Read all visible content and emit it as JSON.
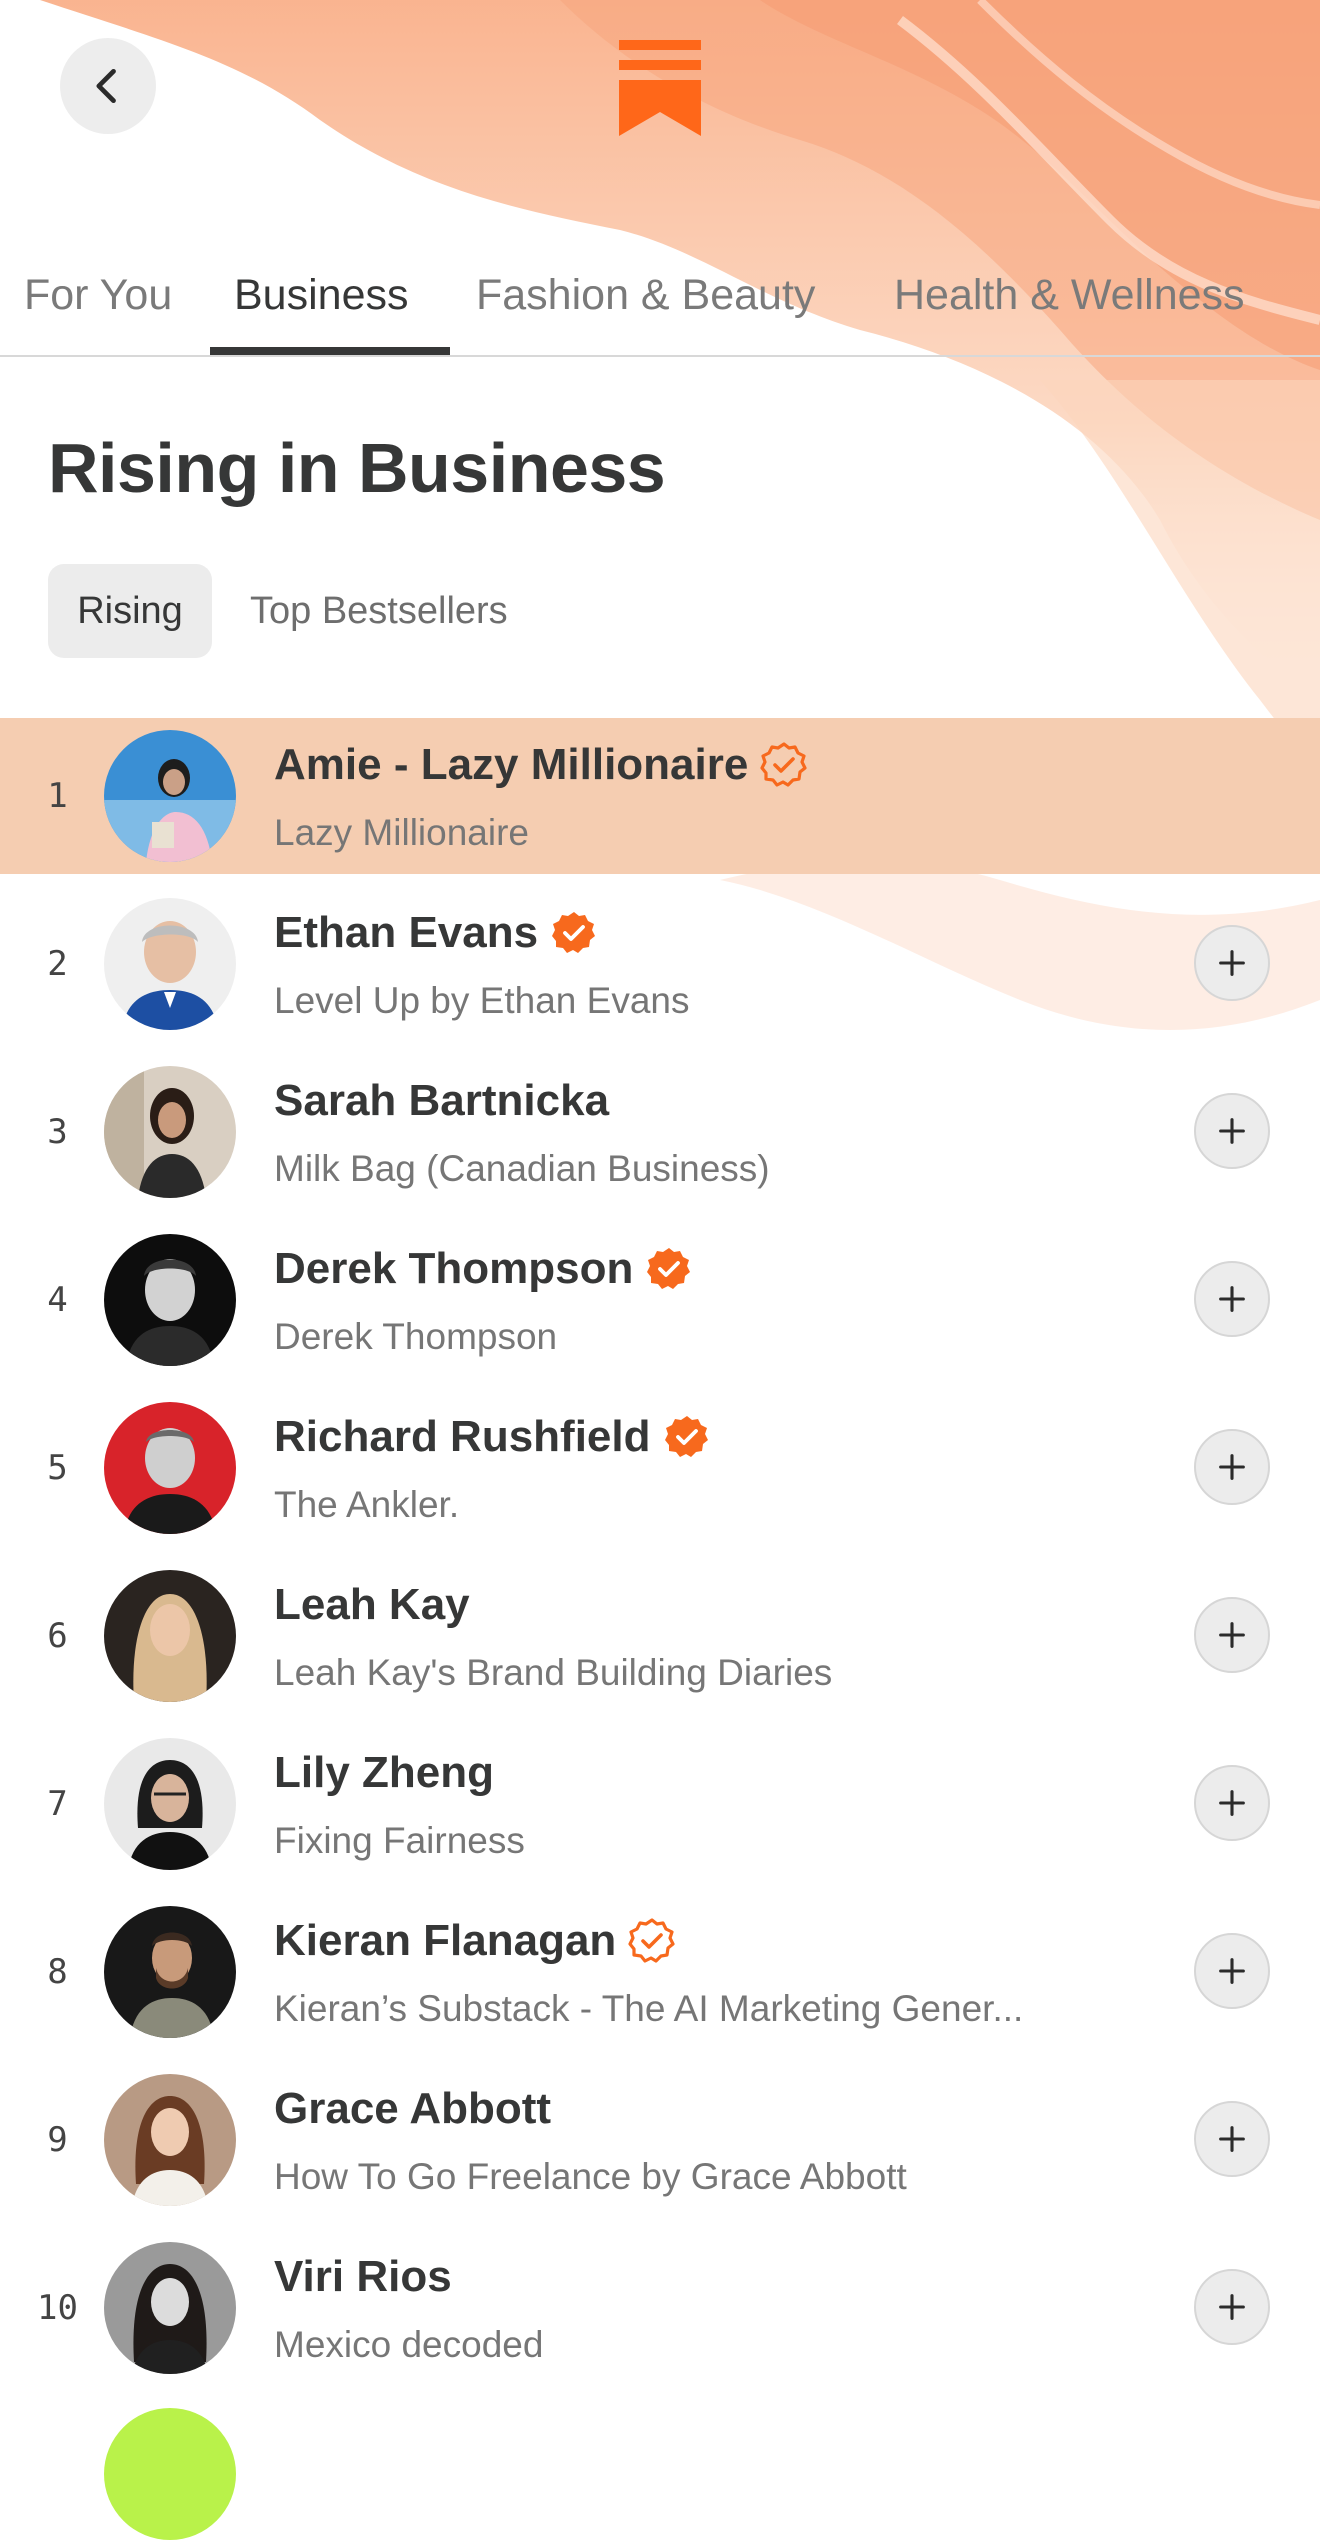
{
  "nav": {
    "back_icon": "chevron-left-icon",
    "logo_icon": "substack-logo-icon",
    "brand_color": "#ff6719"
  },
  "tabs": [
    {
      "label": "For You",
      "active": false
    },
    {
      "label": "Business",
      "active": true
    },
    {
      "label": "Fashion & Beauty",
      "active": false
    },
    {
      "label": "Health & Wellness",
      "active": false
    }
  ],
  "section": {
    "title": "Rising in Business"
  },
  "filters": [
    {
      "label": "Rising",
      "active": true
    },
    {
      "label": "Top Bestsellers",
      "active": false
    }
  ],
  "list": [
    {
      "rank": "1",
      "name": "Amie - Lazy Millionaire",
      "publication": "Lazy Millionaire",
      "badge": "outline",
      "highlighted": true,
      "add_button": false
    },
    {
      "rank": "2",
      "name": "Ethan Evans",
      "publication": "Level Up by Ethan Evans",
      "badge": "filled",
      "highlighted": false,
      "add_button": true
    },
    {
      "rank": "3",
      "name": "Sarah Bartnicka",
      "publication": "Milk Bag (Canadian Business)",
      "badge": "none",
      "highlighted": false,
      "add_button": true
    },
    {
      "rank": "4",
      "name": "Derek Thompson",
      "publication": "Derek Thompson",
      "badge": "filled",
      "highlighted": false,
      "add_button": true
    },
    {
      "rank": "5",
      "name": "Richard Rushfield",
      "publication": "The Ankler.",
      "badge": "filled",
      "highlighted": false,
      "add_button": true
    },
    {
      "rank": "6",
      "name": "Leah Kay",
      "publication": "Leah Kay's Brand Building Diaries",
      "badge": "none",
      "highlighted": false,
      "add_button": true
    },
    {
      "rank": "7",
      "name": "Lily Zheng",
      "publication": "Fixing Fairness",
      "badge": "none",
      "highlighted": false,
      "add_button": true
    },
    {
      "rank": "8",
      "name": "Kieran Flanagan",
      "publication": "Kieran’s Substack - The AI Marketing Gener...",
      "badge": "outline",
      "highlighted": false,
      "add_button": true
    },
    {
      "rank": "9",
      "name": "Grace Abbott",
      "publication": "How To Go Freelance by Grace Abbott",
      "badge": "none",
      "highlighted": false,
      "add_button": true
    },
    {
      "rank": "10",
      "name": "Viri Rios",
      "publication": "Mexico decoded",
      "badge": "none",
      "highlighted": false,
      "add_button": true
    }
  ]
}
